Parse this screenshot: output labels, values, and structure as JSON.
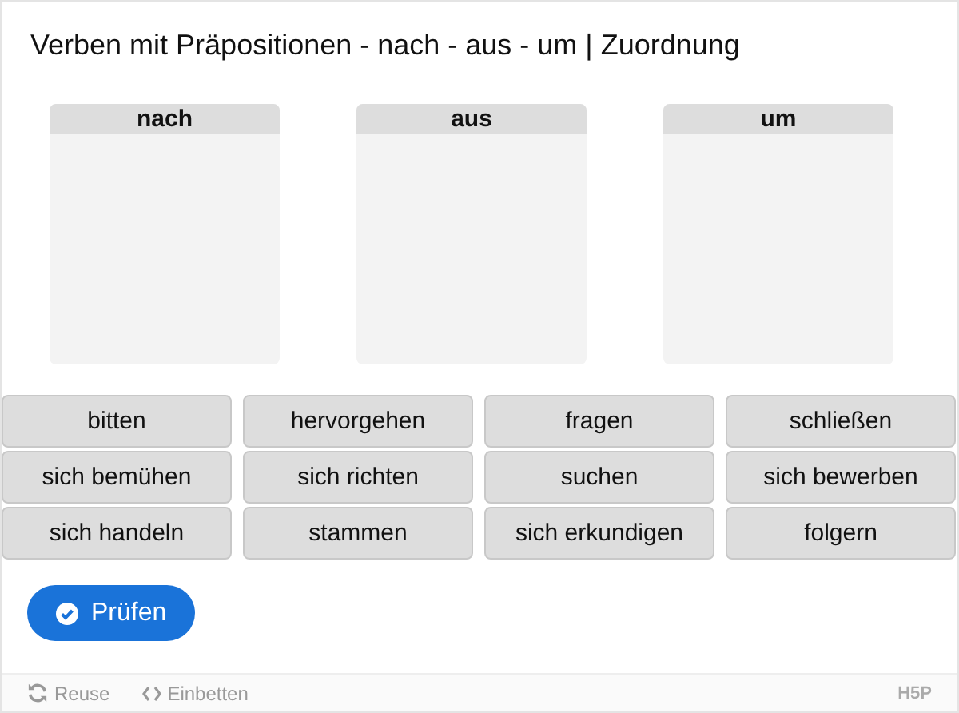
{
  "title": "Verben mit Präpositionen - nach - aus - um | Zuordnung",
  "dropzones": [
    {
      "label": "nach"
    },
    {
      "label": "aus"
    },
    {
      "label": "um"
    }
  ],
  "words": [
    "bitten",
    "hervorgehen",
    "fragen",
    "schließen",
    "sich bemühen",
    "sich richten",
    "suchen",
    "sich bewerben",
    "sich handeln",
    "stammen",
    "sich erkundigen",
    "folgern"
  ],
  "check_button": "Prüfen",
  "footer": {
    "reuse": "Reuse",
    "embed": "Einbetten",
    "logo": "H5P"
  }
}
